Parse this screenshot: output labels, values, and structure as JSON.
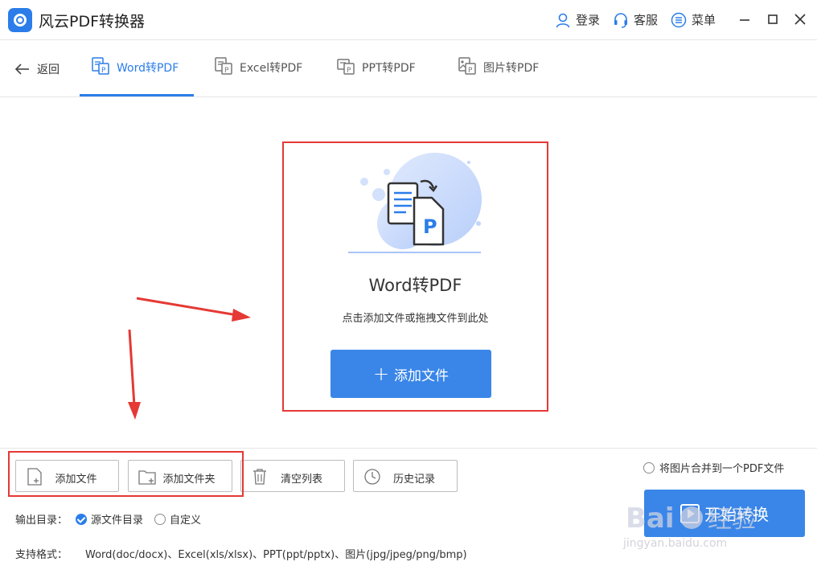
{
  "app": {
    "title": "风云PDF转换器"
  },
  "topbar": {
    "login": "登录",
    "service": "客服",
    "menu": "菜单"
  },
  "nav": {
    "back": "返回",
    "tabs": [
      {
        "label": "Word转PDF",
        "icon": "word-to-pdf-icon",
        "active": true
      },
      {
        "label": "Excel转PDF",
        "icon": "excel-to-pdf-icon",
        "active": false
      },
      {
        "label": "PPT转PDF",
        "icon": "ppt-to-pdf-icon",
        "active": false
      },
      {
        "label": "图片转PDF",
        "icon": "image-to-pdf-icon",
        "active": false
      }
    ]
  },
  "dropzone": {
    "title": "Word转PDF",
    "hint": "点击添加文件或拖拽文件到此处",
    "add_label": "添加文件"
  },
  "toolbar": {
    "add_file": "添加文件",
    "add_folder": "添加文件夹",
    "clear_list": "清空列表",
    "history": "历史记录"
  },
  "options": {
    "merge_images": "将图片合并到一个PDF文件",
    "output_dir_label": "输出目录：",
    "output_source": "源文件目录",
    "output_custom": "自定义",
    "formats_label": "支持格式：",
    "formats": "Word(doc/docx)、Excel(xls/xlsx)、PPT(ppt/pptx)、图片(jpg/jpeg/png/bmp)"
  },
  "start_label": "开始转换",
  "watermark": {
    "brand": "Baidu 经验",
    "url": "jingyan.baidu.com"
  },
  "colors": {
    "accent": "#2b7de9",
    "button": "#3a86e8",
    "highlight": "#e53935"
  }
}
